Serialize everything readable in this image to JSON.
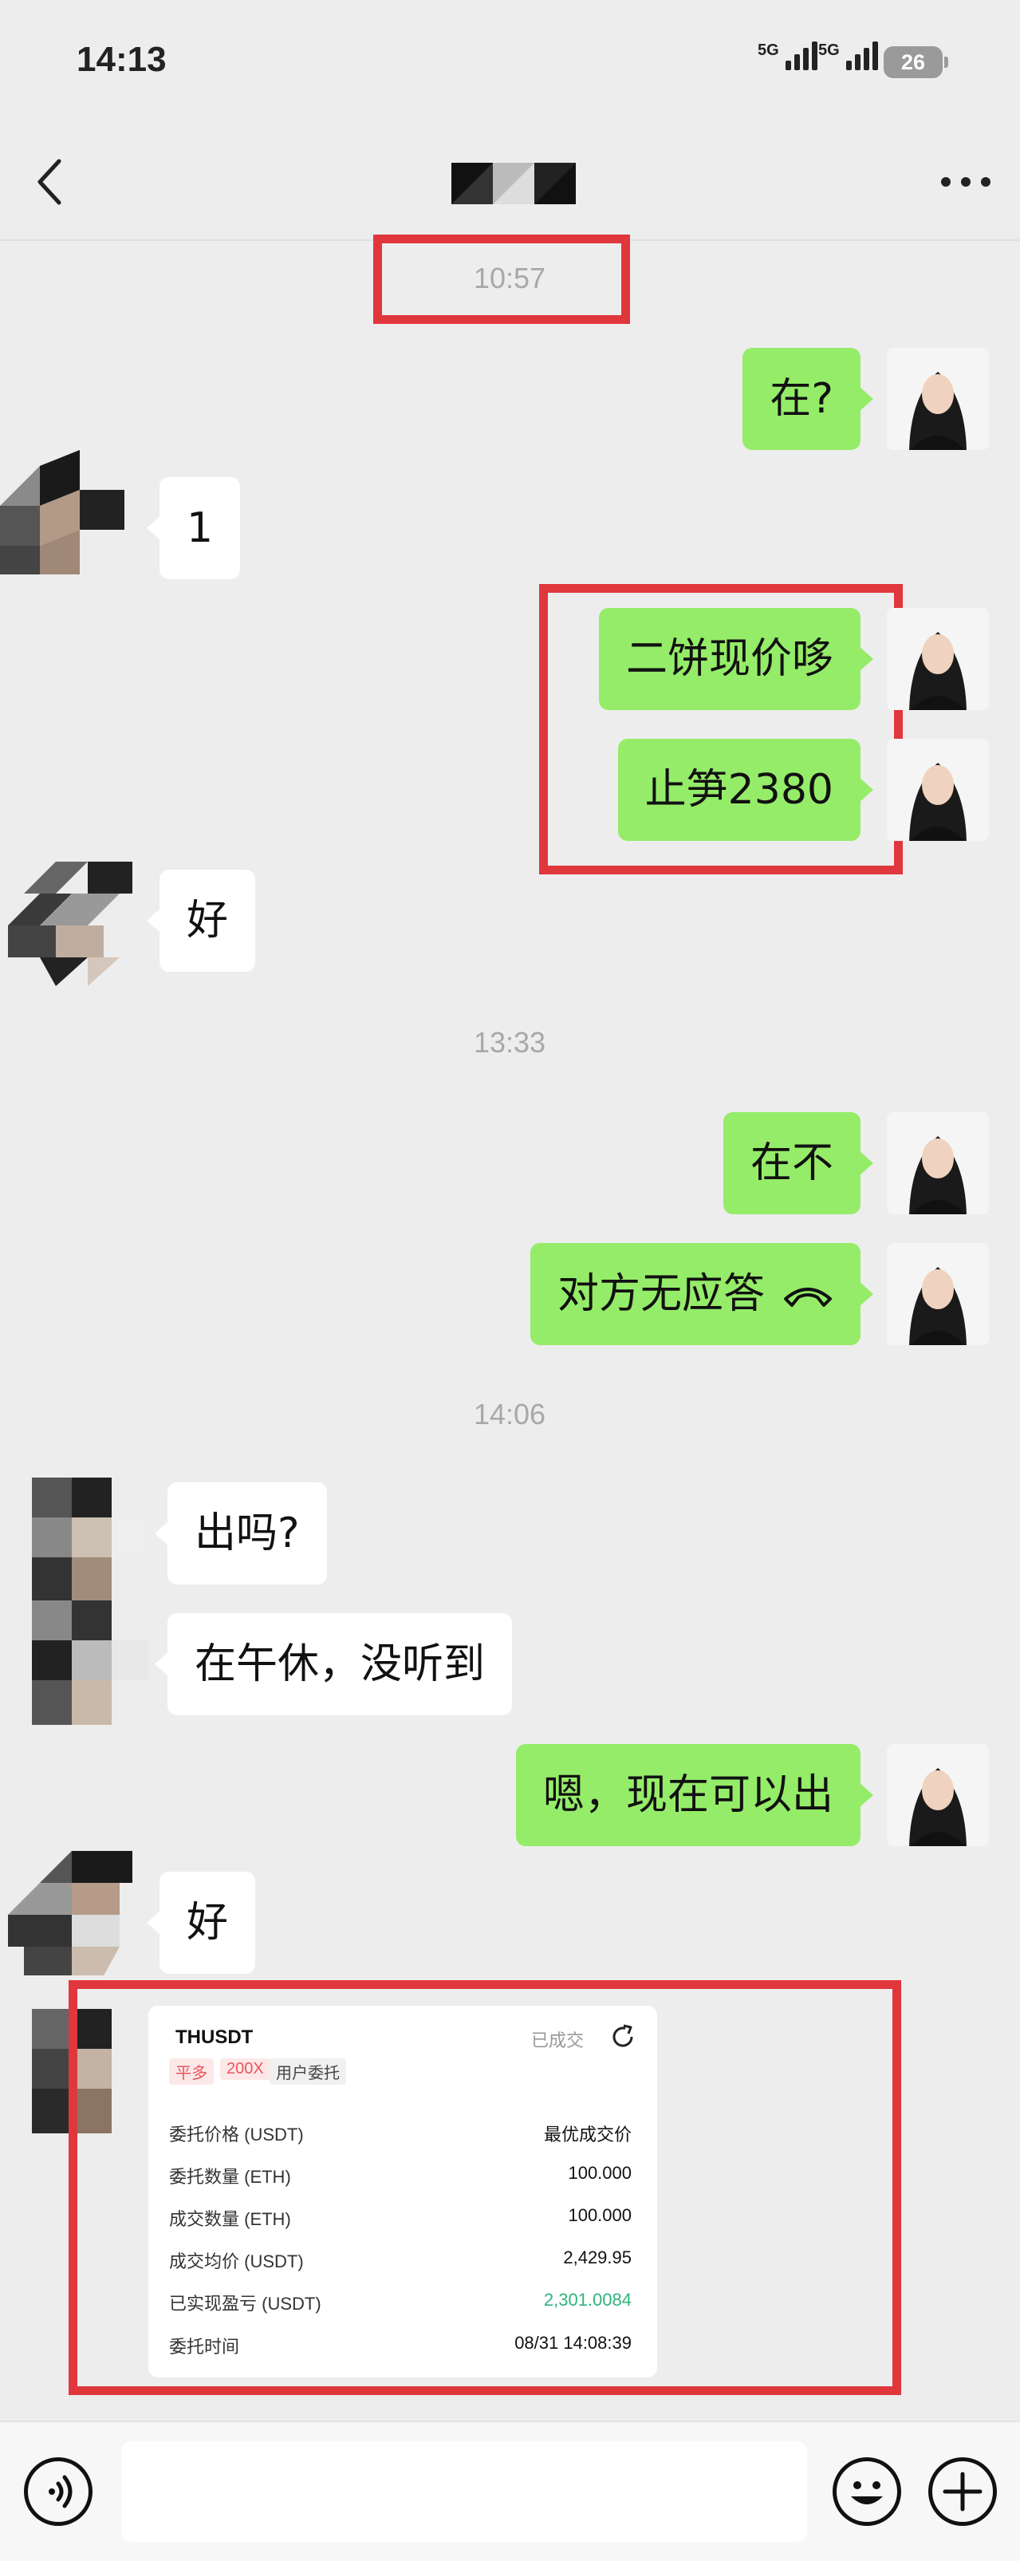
{
  "status_bar": {
    "time": "14:13",
    "network_1": "5G",
    "network_2": "5G",
    "battery": "26"
  },
  "header": {
    "back_icon": "chevron-left-icon",
    "more_icon": "more-horizontal-icon"
  },
  "messages": {
    "ts1": "10:57",
    "m1": "在?",
    "m2": "1",
    "m3": "二饼现价哆",
    "m4": "止笋2380",
    "m5": "好",
    "ts2": "13:33",
    "m6": "在不",
    "m7": "对方无应答",
    "ts3": "14:06",
    "m8": "出吗?",
    "m9": "在午休，没听到",
    "m10": "嗯，现在可以出",
    "m11": "好"
  },
  "order_card": {
    "symbol": "THUSDT",
    "status": "已成交",
    "tags": [
      "平多",
      "200X",
      "用户委托"
    ],
    "rows": [
      {
        "label": "委托价格 (USDT)",
        "value": "最优成交价"
      },
      {
        "label": "委托数量 (ETH)",
        "value": "100.000"
      },
      {
        "label": "成交数量 (ETH)",
        "value": "100.000"
      },
      {
        "label": "成交均价 (USDT)",
        "value": "2,429.95"
      },
      {
        "label": "已实现盈亏 (USDT)",
        "value": "2,301.0084"
      },
      {
        "label": "委托时间",
        "value": "08/31 14:08:39"
      }
    ]
  },
  "colors": {
    "me_bubble": "#95ec69",
    "highlight": "#e0373d",
    "profit": "#2fb47c"
  }
}
